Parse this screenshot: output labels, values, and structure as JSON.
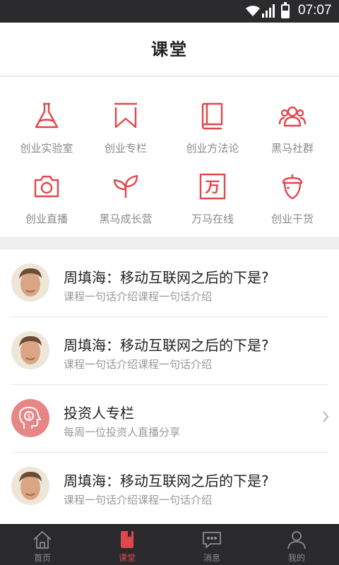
{
  "status": {
    "time": "07:07"
  },
  "header": {
    "title": "课堂"
  },
  "grid": [
    {
      "label": "创业实验室",
      "icon": "flask-icon"
    },
    {
      "label": "创业专栏",
      "icon": "bookmark-icon"
    },
    {
      "label": "创业方法论",
      "icon": "book-icon"
    },
    {
      "label": "黑马社群",
      "icon": "group-icon"
    },
    {
      "label": "创业直播",
      "icon": "camera-icon"
    },
    {
      "label": "黑马成长营",
      "icon": "sprout-icon"
    },
    {
      "label": "万马在线",
      "icon": "wan-icon",
      "glyph": "万"
    },
    {
      "label": "创业干货",
      "icon": "acorn-icon"
    }
  ],
  "list": [
    {
      "title": "周填海：移动互联网之后的下是?",
      "subtitle": "课程一句话介绍课程一句话介绍"
    },
    {
      "title": "周填海：移动互联网之后的下是?",
      "subtitle": "课程一句话介绍课程一句话介绍"
    },
    {
      "title": "投资人专栏",
      "subtitle": "每周一位投资人直播分享"
    },
    {
      "title": "周填海：移动互联网之后的下是?",
      "subtitle": "课程一句话介绍课程一句话介绍"
    }
  ],
  "tabs": [
    {
      "label": "首页",
      "icon": "home-icon",
      "active": false
    },
    {
      "label": "课堂",
      "icon": "classroom-book-icon",
      "active": true
    },
    {
      "label": "消息",
      "icon": "message-icon",
      "active": false
    },
    {
      "label": "我的",
      "icon": "profile-icon",
      "active": false
    }
  ],
  "colors": {
    "accent": "#e0474c",
    "tabbar": "#2a2a2c",
    "statusbar": "#2b2b2d"
  }
}
